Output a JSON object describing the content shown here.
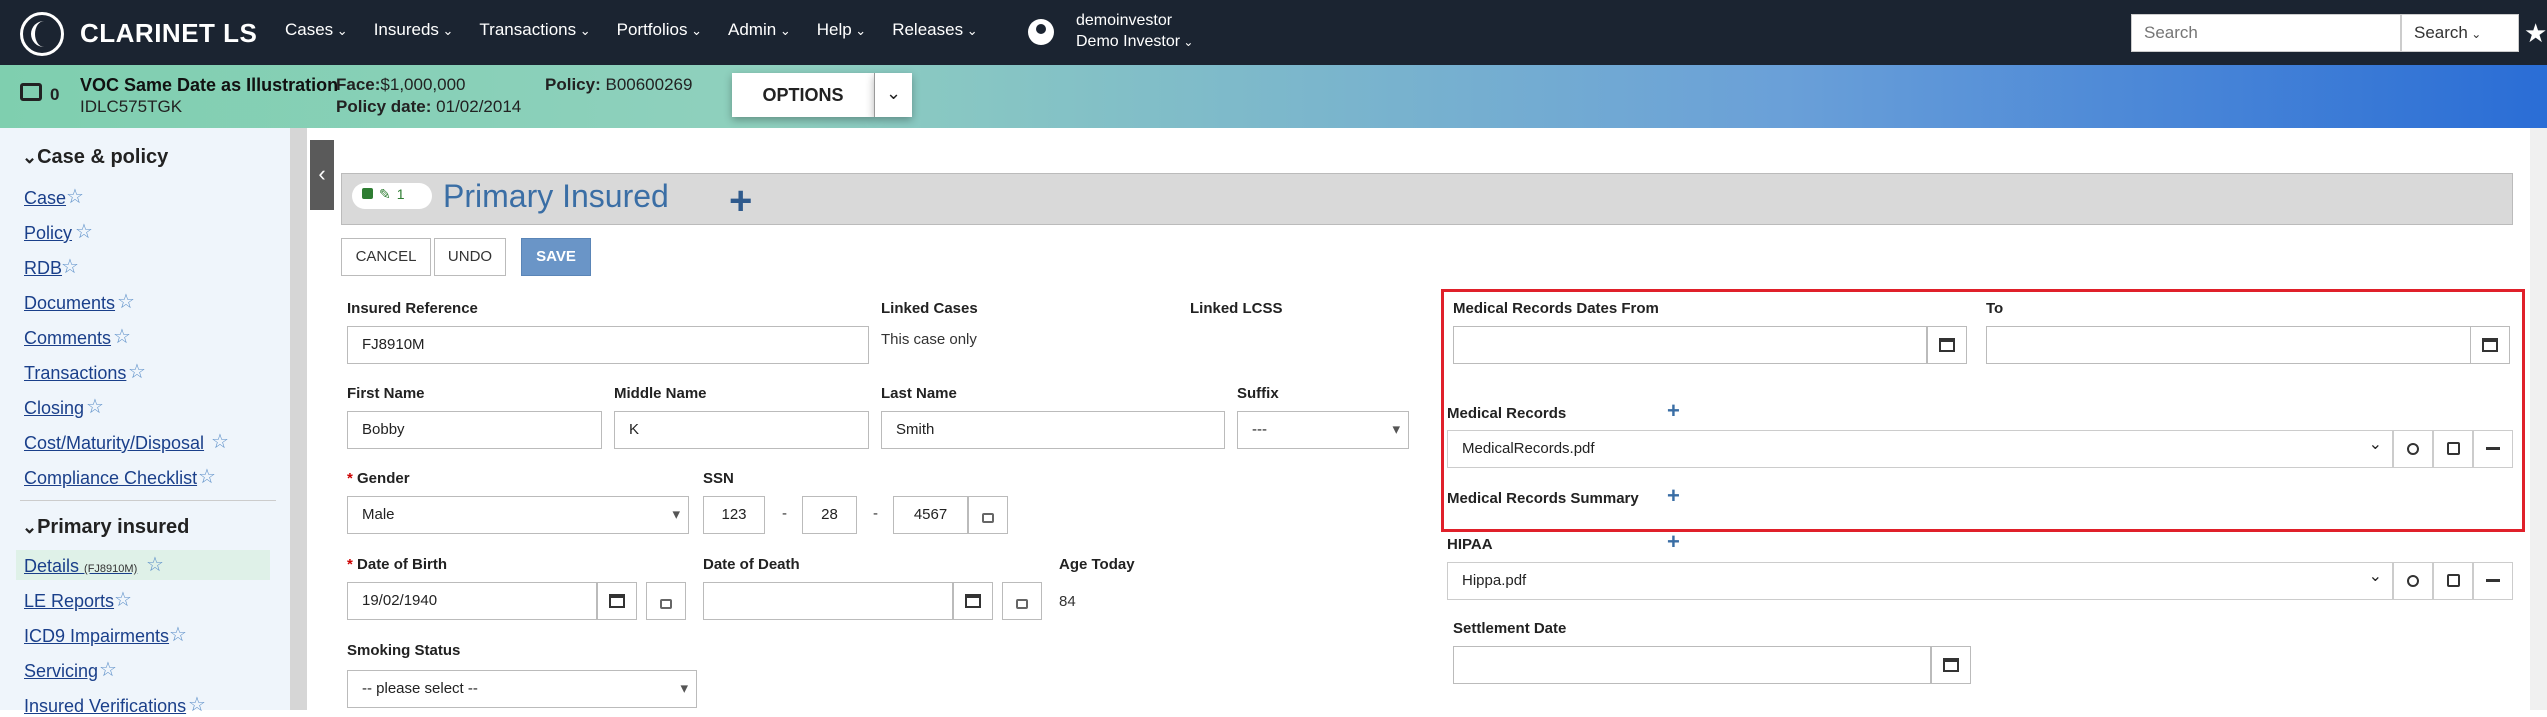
{
  "app": {
    "brand": "CLARINET LS"
  },
  "nav": {
    "items": [
      "Cases",
      "Insureds",
      "Transactions",
      "Portfolios",
      "Admin",
      "Help",
      "Releases"
    ]
  },
  "user": {
    "name": "demoinvestor",
    "display": "Demo Investor"
  },
  "search": {
    "placeholder": "Search",
    "button": "Search"
  },
  "infobar": {
    "lock_count": "0",
    "case_title": "VOC Same Date as Illustration",
    "case_code": "IDLC575TGK",
    "face_label": "Face:",
    "face_value": "$1,000,000",
    "policy_date_label": "Policy date:",
    "policy_date_value": "01/02/2014",
    "policy_label": "Policy:",
    "policy_value": "B00600269",
    "options_label": "OPTIONS"
  },
  "sidebar": {
    "section1": "Case & policy",
    "items1": [
      "Case",
      "Policy",
      "RDB",
      "Documents",
      "Comments",
      "Transactions",
      "Closing",
      "Cost/Maturity/Disposal",
      "Compliance Checklist"
    ],
    "section2": "Primary insured",
    "items2": [
      "Details",
      "LE Reports",
      "ICD9 Impairments",
      "Servicing",
      "Insured Verifications"
    ],
    "details_tag": "(FJ8910M)"
  },
  "panel": {
    "badge_count": "1",
    "title": "Primary Insured"
  },
  "actions": {
    "cancel": "CANCEL",
    "undo": "UNDO",
    "save": "SAVE"
  },
  "form": {
    "insured_reference_label": "Insured Reference",
    "insured_reference": "FJ8910M",
    "linked_cases_label": "Linked Cases",
    "linked_cases": "This case only",
    "linked_lcss_label": "Linked LCSS",
    "first_name_label": "First Name",
    "first_name": "Bobby",
    "middle_name_label": "Middle Name",
    "middle_name": "K",
    "last_name_label": "Last Name",
    "last_name": "Smith",
    "suffix_label": "Suffix",
    "suffix": "---",
    "gender_label": "Gender",
    "gender": "Male",
    "ssn_label": "SSN",
    "ssn1": "123",
    "ssn2": "28",
    "ssn3": "4567",
    "ssn_sep": "-",
    "dob_label": "Date of Birth",
    "dob": "19/02/1940",
    "dod_label": "Date of Death",
    "age_label": "Age Today",
    "age": "84",
    "smoking_label": "Smoking Status",
    "smoking": "-- please select --",
    "required_mark": "*"
  },
  "medical": {
    "dates_from_label": "Medical Records Dates From",
    "to_label": "To",
    "records_label": "Medical Records",
    "records_file": "MedicalRecords.pdf",
    "summary_label": "Medical Records Summary",
    "hipaa_label": "HIPAA",
    "hipaa_file": "Hippa.pdf",
    "settlement_label": "Settlement Date"
  },
  "colors": {
    "nav_bg": "#1b2431",
    "accent": "#3a6ea5",
    "highlight": "#e0202a"
  }
}
